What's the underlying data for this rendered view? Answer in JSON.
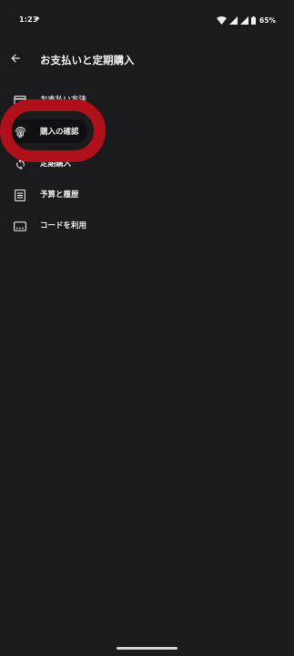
{
  "status_bar": {
    "time": "1:23",
    "battery": "65%"
  },
  "app_bar": {
    "title": "お支払いと定期購入",
    "back_icon": "arrow-back-icon"
  },
  "menu": {
    "items": [
      {
        "label": "お支払い方法",
        "icon": "credit-card-icon"
      },
      {
        "label": "購入の確認",
        "icon": "fingerprint-icon",
        "selected": true
      },
      {
        "label": "定期購入",
        "icon": "sync-icon"
      },
      {
        "label": "予算と履歴",
        "icon": "list-icon"
      },
      {
        "label": "コードを利用",
        "icon": "redeem-code-icon"
      }
    ]
  },
  "colors": {
    "background": "#1b1b1d",
    "highlight": "#b0101a",
    "selected_pill": "#101012",
    "text": "#ececec"
  }
}
